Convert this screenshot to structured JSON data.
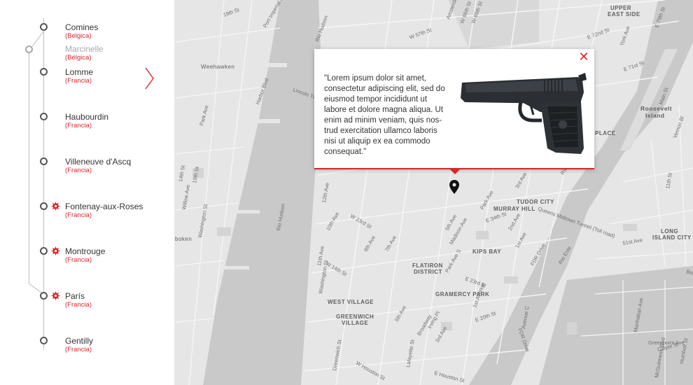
{
  "route": {
    "stops": [
      {
        "name": "Comines",
        "country": "(Bélgica)",
        "state": "normal",
        "marker": "ring"
      },
      {
        "name": "Marcinelle",
        "country": "(Bélgica)",
        "state": "faded",
        "marker": "side-ring"
      },
      {
        "name": "Lomme",
        "country": "(Francia)",
        "state": "active",
        "marker": "ring"
      },
      {
        "name": "Haubourdin",
        "country": "(Francia)",
        "state": "normal",
        "marker": "ring"
      },
      {
        "name": "Villeneuve d'Ascq",
        "country": "(Francia)",
        "state": "normal",
        "marker": "ring"
      },
      {
        "name": "Fontenay-aux-Roses",
        "country": "(Francia)",
        "state": "normal",
        "marker": "ring-burst"
      },
      {
        "name": "Montrouge",
        "country": "(Francia)",
        "state": "normal",
        "marker": "ring-burst"
      },
      {
        "name": "París",
        "country": "(Francia)",
        "state": "normal",
        "marker": "ring-burst"
      },
      {
        "name": "Gentilly",
        "country": "(Francia)",
        "state": "normal",
        "marker": "ring"
      }
    ]
  },
  "popup": {
    "text": "\"Lorem ipsum dolor sit amet, consectetur adipiscing elit, sed do eiusmod tempor incididunt ut labore et dolore magna aliqua. Ut enim ad minim veniam, quis nos-trud exercitation ullamco laboris nisi ut aliquip ex ea commodo consequat.\"",
    "close_icon": "close-icon",
    "image": "pistol-image"
  },
  "map": {
    "neighborhoods": [
      "UPPER EAST SIDE",
      "TUDOR CITY",
      "MURRAY HILL",
      "KIPS BAY",
      "FLATIRON DISTRICT",
      "GRAMERCY PARK",
      "WEST VILLAGE",
      "GREENWICH VILLAGE",
      "LONG ISLAND CITY",
      "Roosevelt Island",
      "Weehawken",
      "Hoboken",
      "PLACE"
    ],
    "streets": [
      "W 57th St",
      "W 66th St",
      "W 65th St",
      "E 72nd St",
      "E 71st St",
      "E 79th St",
      "W 23rd St",
      "W 14th St",
      "E 34th St",
      "E 23rd St",
      "E 20th St",
      "5th Ave",
      "7th Ave",
      "8th Ave",
      "10th Ave",
      "11th Ave",
      "12th Ave",
      "Park Ave",
      "Park Ave S",
      "Madison Ave",
      "Broadway",
      "Lafayette St",
      "1st Ave",
      "2nd Ave",
      "3rd Ave",
      "FDR Drive",
      "Rio Hudson",
      "Rio Este",
      "Lincoln Tunnel",
      "Queens Midtown Tunnel (Toll road)",
      "Port Imperial Blvd",
      "Washington St",
      "Willow Ave",
      "Park Ave",
      "Hudson St",
      "Greenwich St",
      "Amsterdam",
      "West End Ave",
      "Main St",
      "Vernon Blvd",
      "Greenpoint Ave",
      "Calyer St",
      "McGuinness Blvd",
      "Humbolt St",
      "Manhattan Ave",
      "Borden Av",
      "York Ave",
      "51st Ave",
      "11th St",
      "14th St",
      "15th St",
      "19th St",
      "Harbor Blvd",
      "Bergenline Ave",
      "New York Ave",
      "Palisade Ave",
      "Irving Pl",
      "Avenue C"
    ]
  },
  "colors": {
    "accent": "#d9262b",
    "text": "#333333",
    "faded": "#a8a8a8",
    "line": "#bdbdbd"
  }
}
